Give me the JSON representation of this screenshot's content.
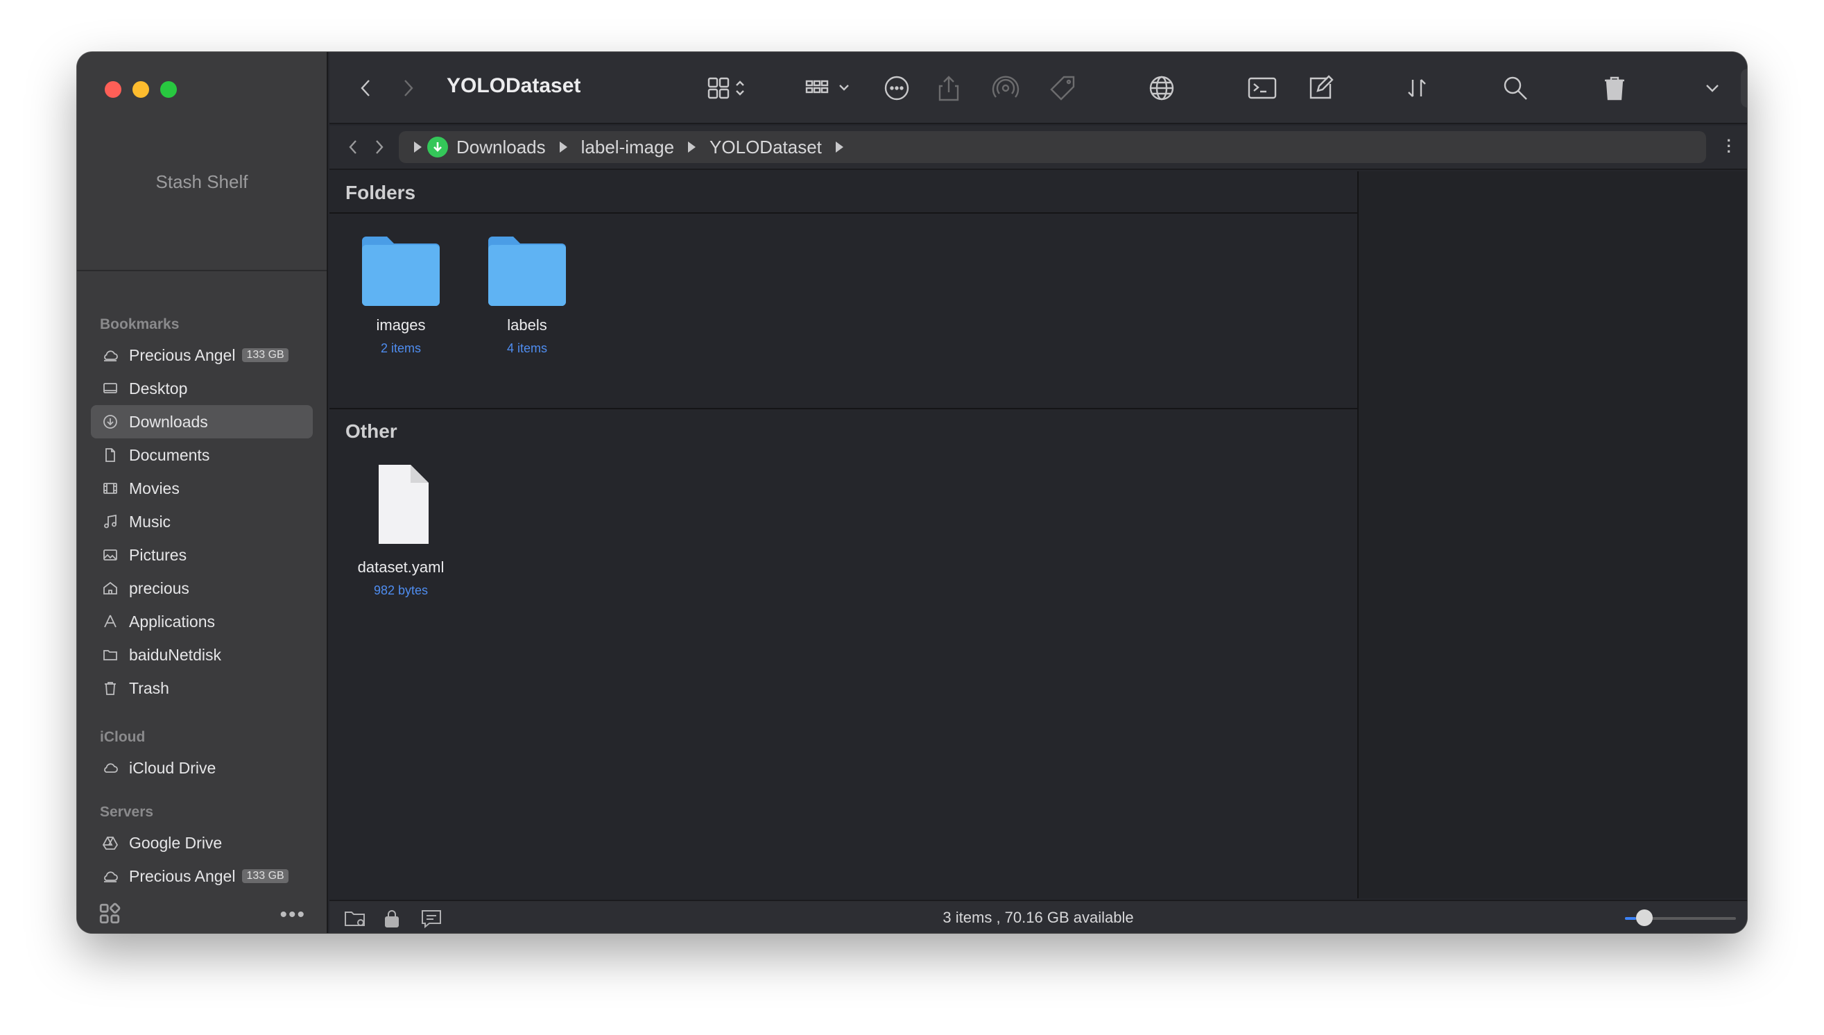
{
  "window": {
    "title": "YOLODataset"
  },
  "sidebar": {
    "shelf_label": "Stash Shelf",
    "sections": [
      {
        "header": "Bookmarks",
        "items": [
          {
            "label": "Precious Angel",
            "badge": "133 GB",
            "icon": "cloud-drive-icon"
          },
          {
            "label": "Desktop",
            "icon": "desktop-icon"
          },
          {
            "label": "Downloads",
            "icon": "download-icon",
            "active": true
          },
          {
            "label": "Documents",
            "icon": "document-icon"
          },
          {
            "label": "Movies",
            "icon": "film-icon"
          },
          {
            "label": "Music",
            "icon": "music-note-icon"
          },
          {
            "label": "Pictures",
            "icon": "photo-icon"
          },
          {
            "label": "precious",
            "icon": "home-icon"
          },
          {
            "label": "Applications",
            "icon": "applications-icon"
          },
          {
            "label": "baiduNetdisk",
            "icon": "folder-icon"
          },
          {
            "label": "Trash",
            "icon": "trash-icon"
          }
        ]
      },
      {
        "header": "iCloud",
        "items": [
          {
            "label": "iCloud Drive",
            "icon": "icloud-icon"
          }
        ]
      },
      {
        "header": "Servers",
        "items": [
          {
            "label": "Google Drive",
            "icon": "google-drive-icon"
          },
          {
            "label": "Precious Angel",
            "badge": "133 GB",
            "icon": "cloud-drive-icon"
          }
        ]
      }
    ]
  },
  "pathbar": {
    "crumbs": [
      "Downloads",
      "label-image",
      "YOLODataset"
    ]
  },
  "content": {
    "groups": [
      {
        "title": "Folders",
        "items": [
          {
            "name": "images",
            "meta": "2 items",
            "kind": "folder"
          },
          {
            "name": "labels",
            "meta": "4 items",
            "kind": "folder"
          }
        ]
      },
      {
        "title": "Other",
        "items": [
          {
            "name": "dataset.yaml",
            "meta": "982 bytes",
            "kind": "file"
          }
        ]
      }
    ]
  },
  "status": {
    "text": "3 items , 70.16 GB available",
    "zoom_fraction": 0.1
  },
  "colors": {
    "accent": "#3b82f6",
    "folder": "#5aacf0",
    "meta_text": "#4f8df0",
    "close": "#fe5f57",
    "minimize": "#febc2e",
    "zoom": "#28c840",
    "downloads_badge": "#34c759"
  }
}
